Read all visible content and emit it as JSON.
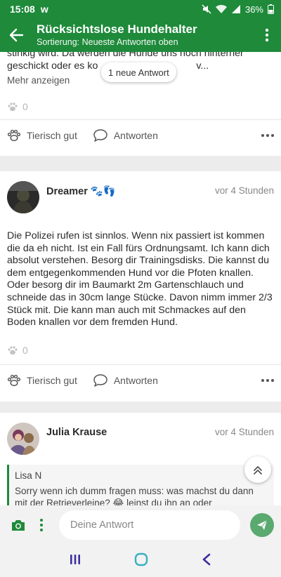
{
  "status": {
    "time": "15:08",
    "battery": "36%"
  },
  "appbar": {
    "title": "Rücksichtslose Hundehalter",
    "subtitle": "Sortierung: Neueste Antworten oben"
  },
  "new_reply_pill": "1 neue Antwort",
  "post1": {
    "text_line1": "stinkig wird. Da werden die Hunde uns noch hinterher",
    "text_line2": "geschickt oder es ko",
    "text_line2_tail": "v...",
    "more": "Mehr anzeigen",
    "likes": "0",
    "like_label": "Tierisch gut",
    "reply_label": "Antworten"
  },
  "post2": {
    "author": "Dreamer",
    "author_emoji": "🐾👣",
    "time": "vor 4 Stunden",
    "text": "Die Polizei rufen ist sinnlos. Wenn nix passiert ist kommen die da eh nicht. Ist ein Fall fürs Ordnungsamt. Ich kann dich absolut verstehen. Besorg dir Trainingsdisks. Die kannst du dem entgegenkommenden Hund vor die Pfoten knallen. Oder besorg dir im Baumarkt 2m Gartenschlauch und schneide das in 30cm lange Stücke. Davon nimm immer 2/3 Stück mit. Die kann man auch mit Schmackes auf den Boden knallen vor dem fremden Hund.",
    "likes": "0",
    "like_label": "Tierisch gut",
    "reply_label": "Antworten"
  },
  "post3": {
    "author": "Julia Krause",
    "time": "vor 4 Stunden",
    "quote_author": "Lisa N",
    "quote_text": "Sorry wenn ich dumm fragen muss: was machst du dann mit der Retrieverleine? 😂 leinst du ihn an oder"
  },
  "reply": {
    "placeholder": "Deine Antwort"
  },
  "colors": {
    "brand": "#1e8a3a",
    "send": "#5aa96f",
    "nav": "#3b2fa0"
  }
}
